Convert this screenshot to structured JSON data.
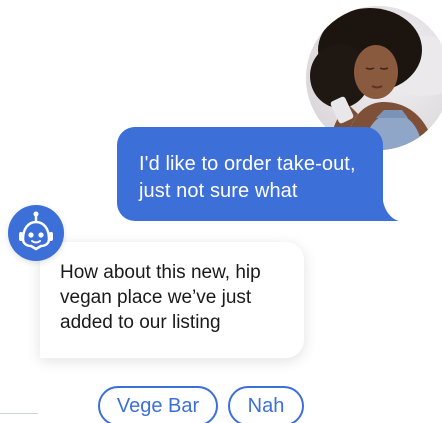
{
  "colors": {
    "accent": "#3d6fd9",
    "bot_bubble_bg": "#ffffff",
    "text_dark": "#1a1a1a"
  },
  "user_message": {
    "lines": [
      "I'd like to order take-out,",
      "just not sure what"
    ]
  },
  "bot": {
    "avatar_icon": "robot-icon",
    "message_lines": [
      "How about this new, hip",
      "vegan place we’ve just",
      "added to our listing"
    ]
  },
  "quick_replies": [
    {
      "label": "Vege Bar"
    },
    {
      "label": "Nah"
    }
  ]
}
